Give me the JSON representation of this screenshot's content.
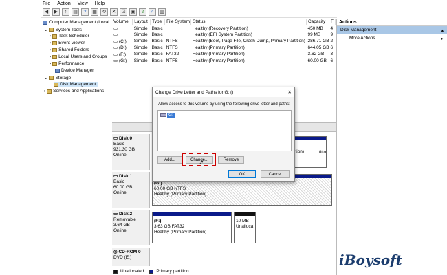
{
  "menu": [
    "File",
    "Action",
    "View",
    "Help"
  ],
  "tree": {
    "root": "Computer Management (Local",
    "system_tools": "System Tools",
    "task_scheduler": "Task Scheduler",
    "event_viewer": "Event Viewer",
    "shared_folders": "Shared Folders",
    "local_users": "Local Users and Groups",
    "performance": "Performance",
    "device_manager": "Device Manager",
    "storage": "Storage",
    "disk_management": "Disk Management",
    "services": "Services and Applications"
  },
  "volume_table": {
    "headers": [
      "Volume",
      "Layout",
      "Type",
      "File System",
      "Status",
      "Capacity",
      "F"
    ],
    "rows": [
      [
        "",
        "Simple",
        "Basic",
        "",
        "Healthy (Recovery Partition)",
        "450 MB",
        "4"
      ],
      [
        "",
        "Simple",
        "Basic",
        "",
        "Healthy (EFI System Partition)",
        "99 MB",
        "9"
      ],
      [
        "(C:)",
        "Simple",
        "Basic",
        "NTFS",
        "Healthy (Boot, Page File, Crash Dump, Primary Partition)",
        "286.71 GB",
        "2"
      ],
      [
        "(D:)",
        "Simple",
        "Basic",
        "NTFS",
        "Healthy (Primary Partition)",
        "644.05 GB",
        "6"
      ],
      [
        "(F:)",
        "Simple",
        "Basic",
        "FAT32",
        "Healthy (Primary Partition)",
        "3.62 GB",
        "3"
      ],
      [
        "(G:)",
        "Simple",
        "Basic",
        "NTFS",
        "Healthy (Primary Partition)",
        "60.00 GB",
        "6"
      ]
    ]
  },
  "disks": {
    "disk0": {
      "name": "Disk 0",
      "type": "Basic",
      "size": "931.30 GB",
      "status": "Online"
    },
    "disk1": {
      "name": "Disk 1",
      "type": "Basic",
      "size": "60.00 GB",
      "status": "Online",
      "part_label": "(G:)",
      "part_size": "60.00 GB NTFS",
      "part_status": "Healthy (Primary Partition)"
    },
    "disk2": {
      "name": "Disk 2",
      "type": "Removable",
      "size": "3.64 GB",
      "status": "Online",
      "part_label": "(F:)",
      "part_size": "3.63 GB FAT32",
      "part_status": "Healthy (Primary Partition)",
      "unalloc_size": "10 MB",
      "unalloc_label": "Unalloca"
    },
    "cdrom": {
      "name": "CD-ROM 0",
      "drive": "DVD (E:)"
    },
    "disk0_part_status_1": "ition)",
    "disk0_part_status_2": "tition)"
  },
  "legend": {
    "unallocated": "Unallocated",
    "primary": "Primary partition"
  },
  "actions": {
    "title": "Actions",
    "section": "Disk Management",
    "more": "More Actions",
    "arrow": "▸"
  },
  "dialog": {
    "title": "Change Drive Letter and Paths for G: ()",
    "close": "✕",
    "description": "Allow access to this volume by using the following drive letter and paths:",
    "list_item": "G:",
    "add": "Add...",
    "change": "Change...",
    "remove": "Remove",
    "ok": "OK",
    "cancel": "Cancel"
  },
  "watermark": "iBoysoft"
}
